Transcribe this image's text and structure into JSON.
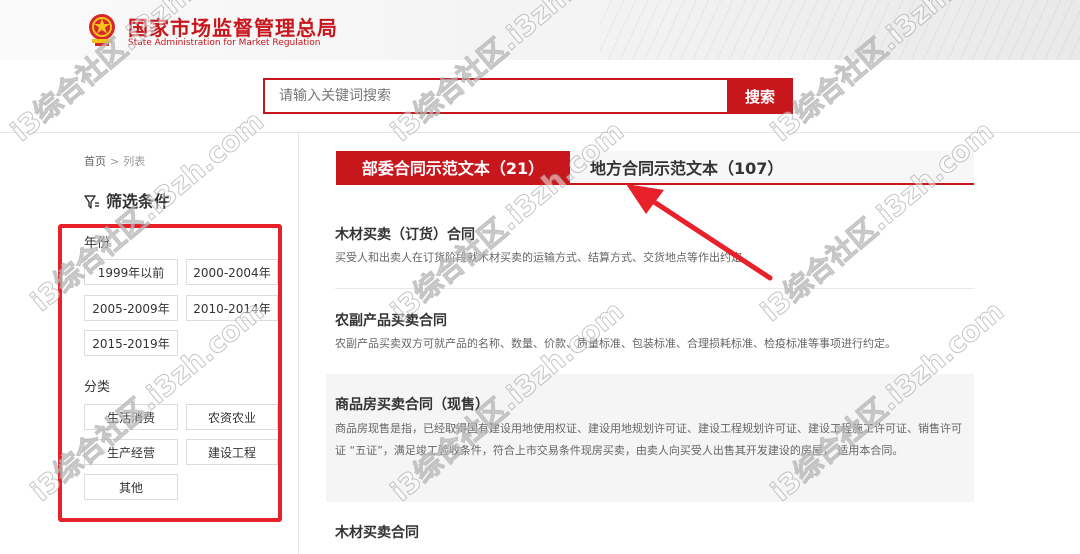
{
  "header": {
    "title": "国家市场监督管理总局",
    "subtitle": "State Administration for Market Regulation"
  },
  "search": {
    "placeholder": "请输入关键词搜索",
    "button_label": "搜索"
  },
  "breadcrumb": {
    "home": "首页",
    "separator": ">",
    "current": "列表"
  },
  "filters": {
    "title": "筛选条件",
    "year_label": "年份",
    "years": [
      "1999年以前",
      "2000-2004年",
      "2005-2009年",
      "2010-2014年",
      "2015-2019年"
    ],
    "category_label": "分类",
    "categories": [
      "生活消费",
      "农资农业",
      "生产经营",
      "建设工程",
      "其他"
    ]
  },
  "tabs": [
    {
      "label": "部委合同示范文本（21）",
      "active": true
    },
    {
      "label": "地方合同示范文本（107）",
      "active": false
    }
  ],
  "contracts": [
    {
      "title": "木材买卖（订货）合同",
      "desc": "买受人和出卖人在订货阶段就木材买卖的运输方式、结算方式、交货地点等作出约定。"
    },
    {
      "title": "农副产品买卖合同",
      "desc": "农副产品买卖双方可就产品的名称、数量、价款、质量标准、包装标准、合理损耗标准、检疫标准等事项进行约定。"
    },
    {
      "title": "商品房买卖合同（现售）",
      "desc": "商品房现售是指，已经取得国有建设用地使用权证、建设用地规划许可证、建设工程规划许可证、建设工程施工许可证、销售许可证 “五证”，满足竣工验收条件，符合上市交易条件现房买卖，由卖人向买受人出售其开发建设的房屋， 适用本合同。"
    },
    {
      "title": "木材买卖合同",
      "desc": ""
    }
  ],
  "watermark": "i3综合社区.i3zh.com",
  "colors": {
    "brand_red": "#c8161d",
    "annotation_red": "#e8202a"
  }
}
